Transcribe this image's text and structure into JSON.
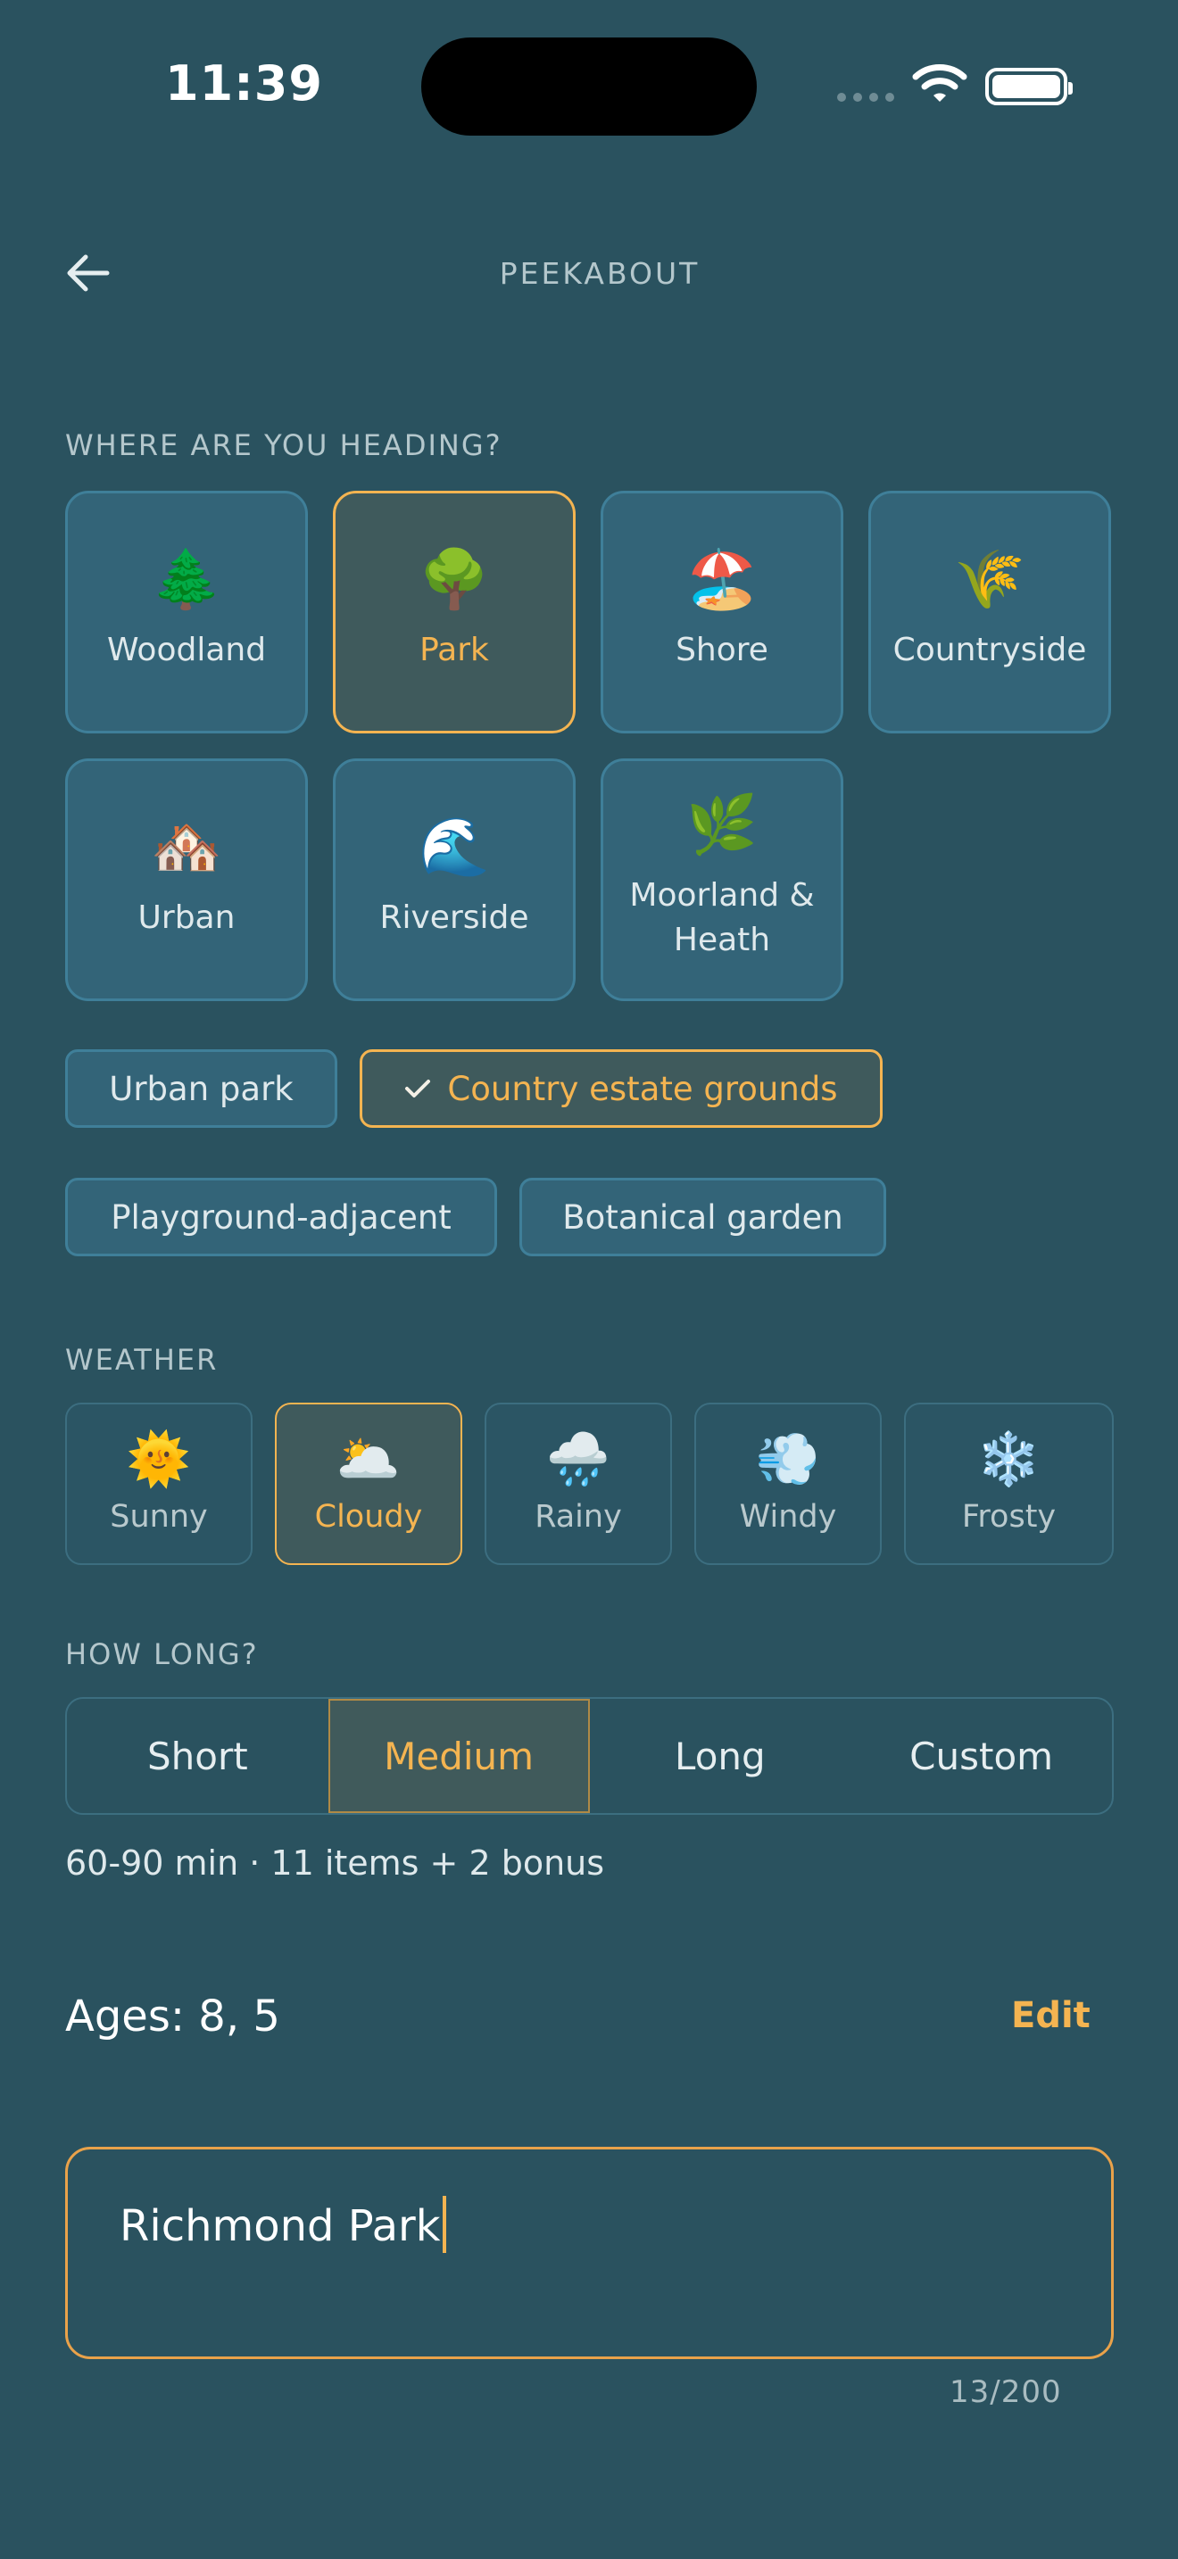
{
  "status_bar": {
    "time": "11:39"
  },
  "header": {
    "title": "PEEKABOUT",
    "back_icon": "arrow-left-icon"
  },
  "destination": {
    "heading": "WHERE ARE YOU HEADING?",
    "tiles": [
      {
        "emoji": "🌲",
        "label": "Woodland",
        "selected": false
      },
      {
        "emoji": "🌳",
        "label": "Park",
        "selected": true
      },
      {
        "emoji": "🏖️",
        "label": "Shore",
        "selected": false
      },
      {
        "emoji": "🌾",
        "label": "Countryside",
        "selected": false
      },
      {
        "emoji": "🏘️",
        "label": "Urban",
        "selected": false
      },
      {
        "emoji": "🌊",
        "label": "Riverside",
        "selected": false
      },
      {
        "emoji": "🌿",
        "label": "Moorland & Heath",
        "selected": false
      }
    ],
    "subtypes": [
      {
        "label": "Urban park",
        "selected": false
      },
      {
        "label": "Country estate grounds",
        "selected": true
      },
      {
        "label": "Playground-adjacent",
        "selected": false
      },
      {
        "label": "Botanical garden",
        "selected": false
      }
    ]
  },
  "weather": {
    "heading": "WEATHER",
    "options": [
      {
        "emoji": "🌞",
        "label": "Sunny",
        "selected": false
      },
      {
        "emoji": "🌥️",
        "label": "Cloudy",
        "selected": true
      },
      {
        "emoji": "🌧️",
        "label": "Rainy",
        "selected": false
      },
      {
        "emoji": "💨",
        "label": "Windy",
        "selected": false
      },
      {
        "emoji": "❄️",
        "label": "Frosty",
        "selected": false
      }
    ]
  },
  "duration": {
    "heading": "HOW LONG?",
    "options": [
      "Short",
      "Medium",
      "Long",
      "Custom"
    ],
    "selected": "Medium",
    "summary": "60-90 min · 11 items + 2 bonus"
  },
  "ages": {
    "label": "Ages: 8, 5",
    "edit_label": "Edit"
  },
  "location_input": {
    "value": "Richmond Park",
    "counter": "13/200"
  },
  "colors": {
    "background": "#2a525f",
    "accent": "#f4b451",
    "tile": "#336478"
  }
}
